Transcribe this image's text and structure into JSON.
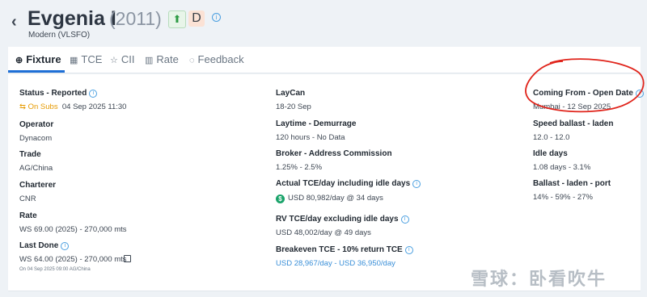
{
  "header": {
    "back_icon": "chevron-left-icon",
    "vessel_name": "Evgenia I",
    "year": "(2011)",
    "badge_up_icon": "arrow-up-icon",
    "badge_letter": "D",
    "subtitle": "Modern (VLSFO)"
  },
  "tabs": [
    {
      "label": "Fixture",
      "icon": "globe-icon"
    },
    {
      "label": "TCE",
      "icon": "grid-icon"
    },
    {
      "label": "CII",
      "icon": "star-icon"
    },
    {
      "label": "Rate",
      "icon": "bar-chart-icon"
    },
    {
      "label": "Feedback",
      "icon": "chat-icon"
    }
  ],
  "fixture": {
    "col1": {
      "status_label": "Status - Reported",
      "status_badge": "On Subs",
      "status_date": "04 Sep 2025 11:30",
      "operator_label": "Operator",
      "operator_value": "Dynacom",
      "trade_label": "Trade",
      "trade_value": "AG/China",
      "charterer_label": "Charterer",
      "charterer_value": "CNR",
      "rate_label": "Rate",
      "rate_value": "WS 69.00 (2025) - 270,000 mts",
      "lastdone_label": "Last Done",
      "lastdone_value": "WS 64.00 (2025) - 270,000 mts",
      "lastdone_note": "On 04 Sep 2025 09:00 AG/China"
    },
    "col2": {
      "laycan_label": "LayCan",
      "laycan_value": "18-20 Sep",
      "laytime_label": "Laytime - Demurrage",
      "laytime_value": "120 hours - No Data",
      "broker_label": "Broker - Address Commission",
      "broker_value": "1.25% - 2.5%",
      "actual_tce_label": "Actual TCE/day including idle days",
      "actual_tce_value": "USD 80,982/day @ 34 days",
      "rv_tce_label": "RV TCE/day excluding idle days",
      "rv_tce_value": "USD 48,002/day @ 49 days",
      "breakeven_label": "Breakeven TCE - 10% return TCE",
      "breakeven_value": "USD 28,967/day - USD 36,950/day"
    },
    "col3": {
      "coming_from_label": "Coming From - Open Date",
      "coming_from_value": "Mumbai - 12 Sep 2025",
      "speed_label": "Speed ballast - laden",
      "speed_value": "12.0 - 12.0",
      "idle_label": "Idle days",
      "idle_value": "1.08 days - 3.1%",
      "ballast_label": "Ballast - laden - port",
      "ballast_value": "14% - 59% - 27%"
    }
  },
  "watermark": "雪球：卧看吹牛",
  "colors": {
    "accent": "#1e6fd6",
    "on_subs": "#e69a00",
    "link": "#3a8fd8",
    "annotation": "#e0241b"
  }
}
